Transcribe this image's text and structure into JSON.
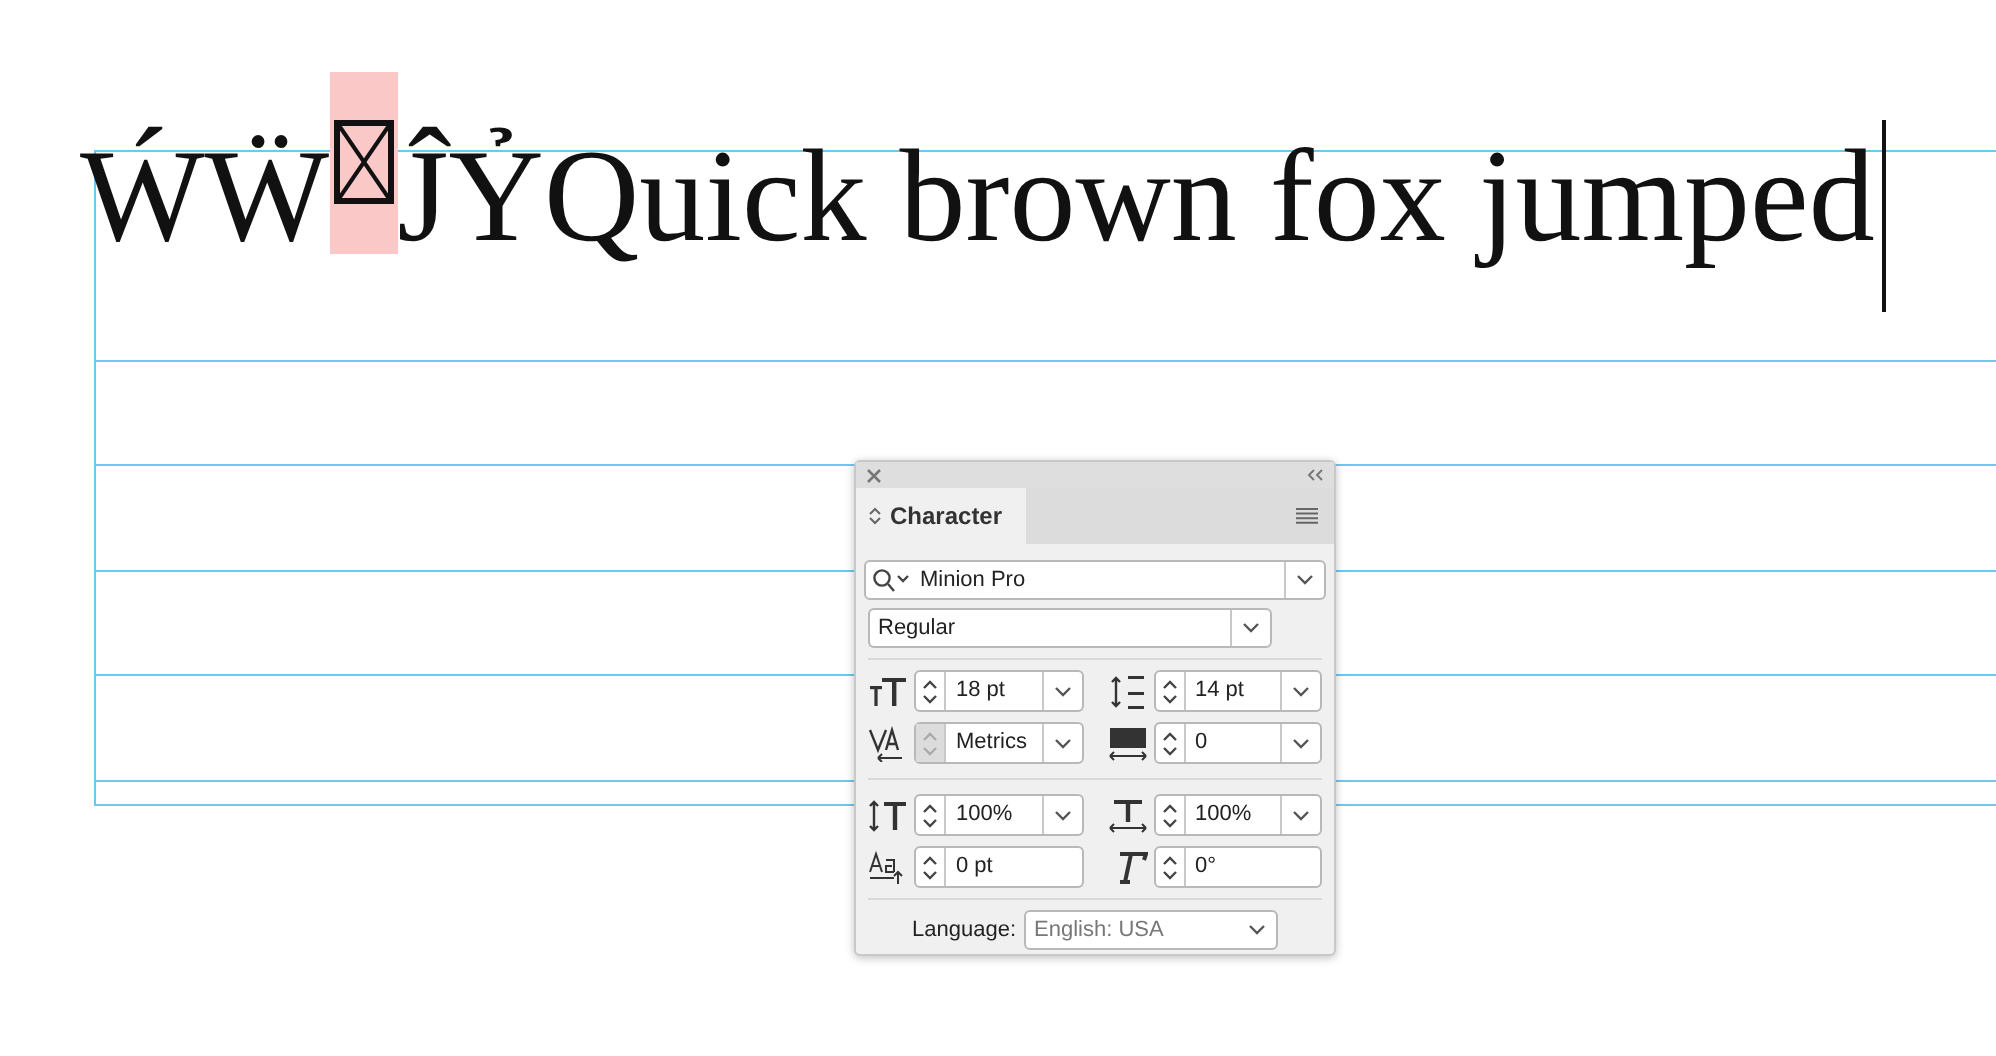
{
  "document": {
    "text_runs": [
      {
        "kind": "text",
        "text": "ẂẄ"
      },
      {
        "kind": "missing_glyph",
        "highlighted": true
      },
      {
        "kind": "text",
        "text": "ĴỶQuick brown fox jumped"
      }
    ],
    "cursor": true
  },
  "panel": {
    "tab": "Character",
    "font_family": "Minion Pro",
    "font_style": "Regular",
    "fields": [
      {
        "kind": "combo",
        "value": "18 pt",
        "stepper_disabled": false
      },
      {
        "kind": "combo",
        "value": "14 pt",
        "stepper_disabled": false
      },
      {
        "kind": "combo",
        "value": "Metrics",
        "stepper_disabled": true
      },
      {
        "kind": "combo",
        "value": "0",
        "stepper_disabled": false
      },
      {
        "kind": "combo",
        "value": "100%",
        "stepper_disabled": false
      },
      {
        "kind": "combo",
        "value": "100%",
        "stepper_disabled": false
      },
      {
        "kind": "plain",
        "value": "0 pt",
        "stepper_disabled": false
      },
      {
        "kind": "plain",
        "value": "0°",
        "stepper_disabled": false
      }
    ],
    "language_label": "Language:",
    "language": "English: USA"
  }
}
